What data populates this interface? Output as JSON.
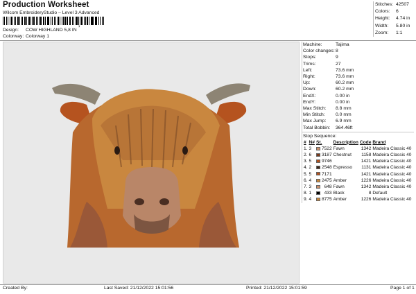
{
  "header": {
    "title": "Production Worksheet",
    "subtitle": "Wilcom EmbroideryStudio – Level 3 Advanced",
    "barcode_tail": ",",
    "design_label": "Design:",
    "design_value": "COW HIGHLAND 5,8 IN",
    "colorway_label": "Colorway:",
    "colorway_value": "Colorway 1"
  },
  "summary": [
    {
      "label": "Stitches:",
      "value": "42507"
    },
    {
      "label": "Colors:",
      "value": "6"
    },
    {
      "label": "Height:",
      "value": "4.74 in"
    },
    {
      "label": "Width:",
      "value": "5.80 in"
    },
    {
      "label": "Zoom:",
      "value": "1:1"
    }
  ],
  "machine_info": [
    {
      "label": "Machine:",
      "value": "Tajima"
    },
    {
      "label": "Color changes:",
      "value": "8"
    },
    {
      "label": "Stops:",
      "value": "9"
    },
    {
      "label": "Trims:",
      "value": "27"
    },
    {
      "label": "Left:",
      "value": "73.6 mm"
    },
    {
      "label": "Right:",
      "value": "73.6 mm"
    },
    {
      "label": "Up:",
      "value": "60.2 mm"
    },
    {
      "label": "Down:",
      "value": "60.2 mm"
    },
    {
      "label": "EndX:",
      "value": "0.00 in"
    },
    {
      "label": "EndY:",
      "value": "0.00 in"
    },
    {
      "label": "Max Stitch:",
      "value": "8.8 mm"
    },
    {
      "label": "Min Stitch:",
      "value": "0.0 mm"
    },
    {
      "label": "Max Jump:",
      "value": "6.9 mm"
    },
    {
      "label": "Total Bobbin:",
      "value": "364.46ft"
    }
  ],
  "stop_sequence": {
    "title": "Stop Sequence:",
    "headers": [
      "#",
      "N#",
      "St.",
      "Description",
      "Code",
      "Brand"
    ],
    "rows": [
      {
        "num": "1.",
        "n": "3",
        "color": "#c98f6a",
        "st": "7522",
        "desc": "Fawn",
        "code": "1342",
        "brand": "Madeira Classic 40"
      },
      {
        "num": "2.",
        "n": "6",
        "color": "#7a3a1c",
        "st": "3187",
        "desc": "Chestnut",
        "code": "1158",
        "brand": "Madeira Classic 40"
      },
      {
        "num": "3.",
        "n": "5",
        "color": "#b0521e",
        "st": "9746",
        "desc": "",
        "code": "1421",
        "brand": "Madeira Classic 40"
      },
      {
        "num": "4.",
        "n": "2",
        "color": "#3b2518",
        "st": "2548",
        "desc": "Espresso",
        "code": "1131",
        "brand": "Madeira Classic 40"
      },
      {
        "num": "5.",
        "n": "5",
        "color": "#b0521e",
        "st": "7171",
        "desc": "",
        "code": "1421",
        "brand": "Madeira Classic 40"
      },
      {
        "num": "6.",
        "n": "4",
        "color": "#c8873a",
        "st": "2475",
        "desc": "Amber",
        "code": "1226",
        "brand": "Madeira Classic 40"
      },
      {
        "num": "7.",
        "n": "3",
        "color": "#c98f6a",
        "st": "648",
        "desc": "Fawn",
        "code": "1342",
        "brand": "Madeira Classic 40"
      },
      {
        "num": "8.",
        "n": "1",
        "color": "#000000",
        "st": "433",
        "desc": "Black",
        "code": "8",
        "brand": "Default"
      },
      {
        "num": "9.",
        "n": "4",
        "color": "#c8873a",
        "st": "8775",
        "desc": "Amber",
        "code": "1226",
        "brand": "Madeira Classic 40"
      }
    ]
  },
  "footer": {
    "created_by": "Created By:",
    "last_saved": "Last Saved: 21/12/2022 15:01:56",
    "printed": "Printed: 21/12/2022 15:01:59",
    "page": "Page 1 of 1"
  }
}
